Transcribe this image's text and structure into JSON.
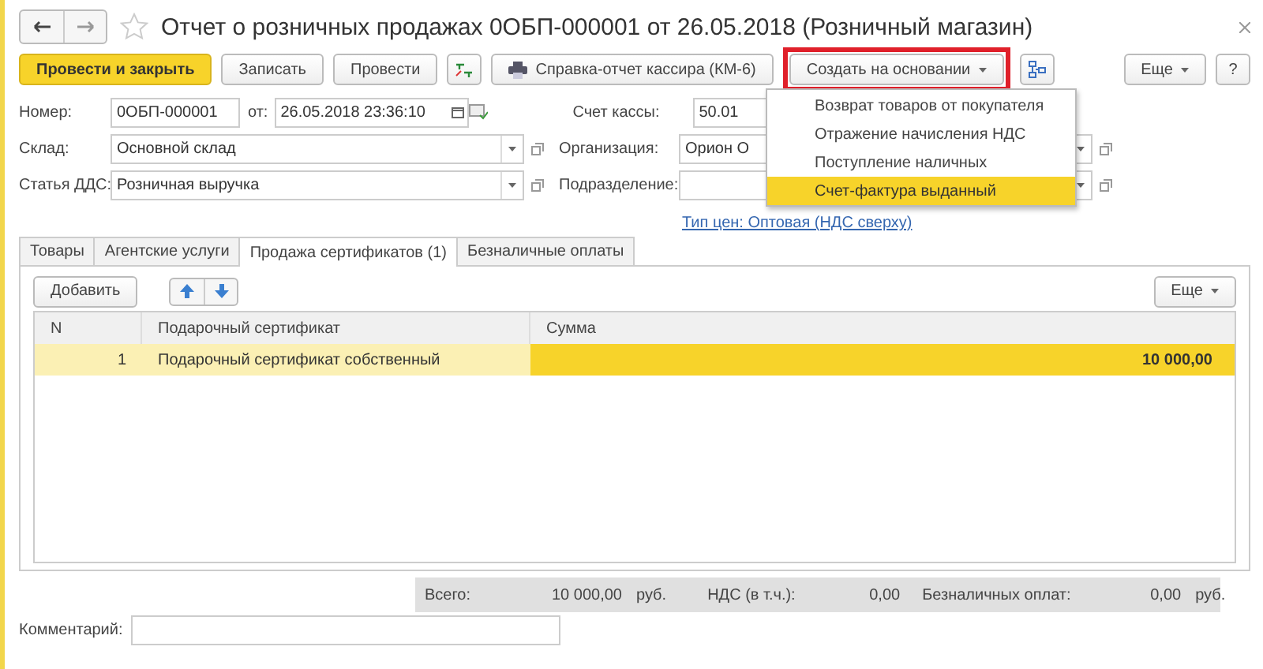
{
  "window": {
    "title": "Отчет о розничных продажах 0ОБП-000001 от 26.05.2018 (Розничный магазин)"
  },
  "toolbar": {
    "buttons": [
      {
        "kind": "primary",
        "label": "Провести и закрыть"
      },
      {
        "kind": "plain",
        "label": "Записать"
      },
      {
        "kind": "plain",
        "label": "Провести"
      },
      {
        "kind": "dtkt"
      },
      {
        "kind": "print",
        "label": "Справка-отчет кассира (КМ-6)"
      },
      {
        "kind": "dropdown",
        "label": "Создать на основании",
        "highlighted": true
      },
      {
        "kind": "structure"
      }
    ],
    "more": "Еще",
    "help": "?"
  },
  "create_menu": [
    {
      "label": "Возврат товаров от покупателя",
      "selected": false
    },
    {
      "label": "Отражение начисления НДС",
      "selected": false
    },
    {
      "label": "Поступление наличных",
      "selected": false
    },
    {
      "label": "Счет-фактура выданный",
      "selected": true
    }
  ],
  "form": {
    "number": {
      "label": "Номер:",
      "value": "0ОБП-000001"
    },
    "date": {
      "label": "от:",
      "value": "26.05.2018 23:36:10"
    },
    "cash_account": {
      "label": "Счет кассы:",
      "value": "50.01"
    },
    "warehouse": {
      "label": "Склад:",
      "value": "Основной склад"
    },
    "organization": {
      "label": "Организация:",
      "value": "Орион О"
    },
    "cash_flow_item": {
      "label": "Статья ДДС:",
      "value": "Розничная выручка"
    },
    "department": {
      "label": "Подразделение:"
    },
    "price_type_link": "Тип цен: Оптовая (НДС сверху)"
  },
  "tabs": [
    {
      "label": "Товары",
      "selected": false
    },
    {
      "label": "Агентские услуги",
      "selected": false
    },
    {
      "label": "Продажа сертификатов (1)",
      "selected": true
    },
    {
      "label": "Безналичные оплаты",
      "selected": false
    }
  ],
  "table_toolbar": {
    "add": "Добавить",
    "more": "Еще"
  },
  "table": {
    "columns": [
      "N",
      "Подарочный сертификат",
      "Сумма"
    ],
    "rows": [
      {
        "cells": [
          "1",
          "Подарочный сертификат собственный",
          "10 000,00"
        ],
        "selected": true
      }
    ]
  },
  "totals": [
    {
      "label": "Всего:",
      "value": "10 000,00",
      "unit": "руб."
    },
    {
      "label": "НДС (в т.ч.):",
      "value": "0,00"
    },
    {
      "label": "Безналичных оплат:",
      "value": "0,00",
      "unit": "руб."
    }
  ],
  "comment": {
    "label": "Комментарий:"
  }
}
